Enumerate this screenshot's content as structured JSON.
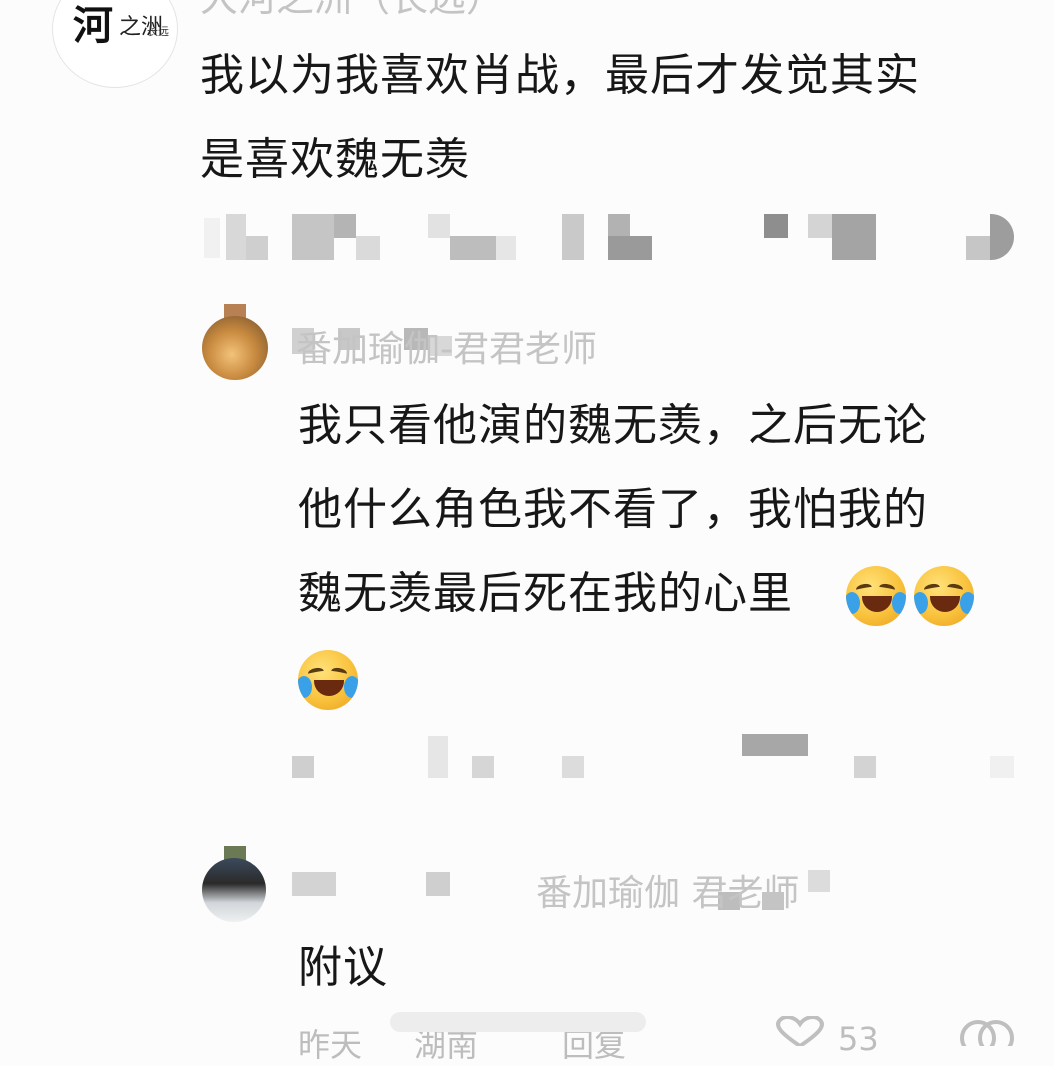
{
  "comments": [
    {
      "username": "大河之洲（长远）",
      "text_line1": "我以为我喜欢肖战，最后才发觉其实",
      "text_line2": "是喜欢魏无羡"
    }
  ],
  "replies": [
    {
      "username_visible": "番加瑜伽-君君老师",
      "text_line1": "我只看他演的魏无羡，之后无论",
      "text_line2": "他什么角色我不看了，我怕我的",
      "text_line3": "魏无羡最后死在我的心里"
    },
    {
      "username_visible": "番加瑜伽 君老师",
      "text": "附议",
      "time": "昨天",
      "location": "湖南",
      "reply_label": "回复",
      "likes": "53"
    }
  ],
  "icons": {
    "avatar_logo_chars": [
      "河",
      "之洲",
      "长远"
    ],
    "heart": "heart-icon",
    "comment": "comment-icon",
    "emoji": "laugh-cry-emoji"
  }
}
